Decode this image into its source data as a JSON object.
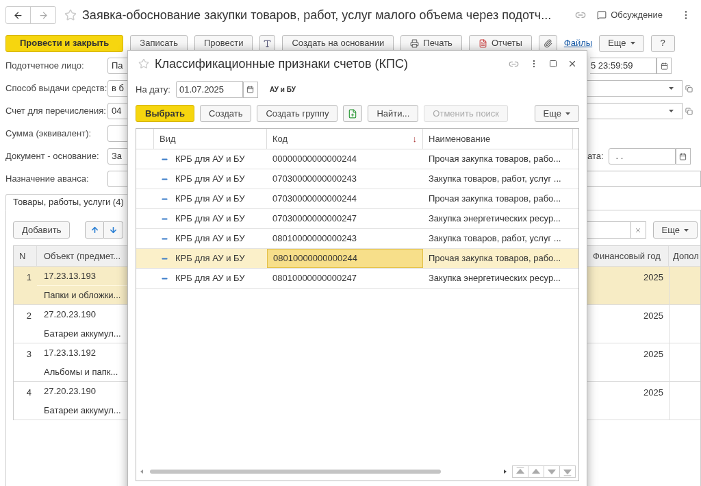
{
  "window": {
    "title": "Заявка-обоснование закупки товаров, работ, услуг малого объема через подотч...",
    "discussion": "Обсуждение"
  },
  "toolbar": [
    {
      "kind": "primary",
      "label": "Провести и закрыть"
    },
    {
      "kind": "plain",
      "label": "Записать"
    },
    {
      "kind": "plain",
      "label": "Провести"
    },
    {
      "kind": "format"
    },
    {
      "kind": "plain",
      "label": "Создать на основании"
    },
    {
      "kind": "printer",
      "label": "Печать"
    },
    {
      "kind": "report",
      "label": "Отчеты"
    },
    {
      "kind": "clip"
    },
    {
      "kind": "link",
      "label": "Файлы"
    },
    {
      "kind": "menu",
      "label": "Еще"
    },
    {
      "kind": "plain",
      "label": "?"
    }
  ],
  "form": [
    {
      "label": "Подотчетное лицо:",
      "value": "Па",
      "right": {
        "kind": "date",
        "value": "5 23:59:59"
      }
    },
    {
      "label": "Способ выдачи средств:",
      "value": "в б",
      "right": {
        "kind": "select"
      }
    },
    {
      "label": "Счет для перечисления:",
      "value": "04",
      "right": {
        "kind": "select"
      }
    },
    {
      "label": "Сумма (эквивалент):",
      "right": {
        "kind": "none"
      }
    },
    {
      "label": "Документ - основание:",
      "value": "За",
      "right": {
        "kind": "labeled-date",
        "label": "ата:",
        "value": ". ."
      }
    },
    {
      "label": "Назначение аванса:",
      "right": {
        "kind": "blank"
      }
    }
  ],
  "tabs": [
    {
      "label": "Товары, работы, услуги (4)",
      "selected": true
    }
  ],
  "items": {
    "add": "Добавить",
    "more": "Еще",
    "columns": [
      "N",
      "Объект (предмет...",
      "Финансовый год",
      "Допол"
    ],
    "rows": [
      {
        "n": "1",
        "code": "17.23.13.193",
        "name": "Папки и обложки...",
        "year": "2025",
        "selected": true
      },
      {
        "n": "2",
        "code": "27.20.23.190",
        "name": "Батареи аккумул...",
        "year": "2025",
        "selected": false
      },
      {
        "n": "3",
        "code": "17.23.13.192",
        "name": "Альбомы и папк...",
        "year": "2025",
        "selected": false
      },
      {
        "n": "4",
        "code": "27.20.23.190",
        "name": "Батареи аккумул...",
        "year": "2025",
        "selected": false
      }
    ]
  },
  "dialog": {
    "title": "Классификационные признаки счетов (КПС)",
    "date_label": "На дату:",
    "date": "01.07.2025",
    "ledger": "АУ и БУ",
    "buttons": [
      {
        "kind": "primary",
        "label": "Выбрать",
        "disabled": false
      },
      {
        "kind": "plain",
        "label": "Создать",
        "disabled": false
      },
      {
        "kind": "plain",
        "label": "Создать группу",
        "disabled": false
      },
      {
        "kind": "add-doc",
        "disabled": false
      },
      {
        "kind": "plain",
        "label": "Найти...",
        "disabled": false
      },
      {
        "kind": "plain",
        "label": "Отменить поиск",
        "disabled": true
      },
      {
        "kind": "menu",
        "label": "Еще",
        "disabled": false
      }
    ],
    "columns": [
      {
        "label": "Вид"
      },
      {
        "label": "Код",
        "sort_mark": "↓"
      },
      {
        "label": "Наименование"
      }
    ],
    "rows": [
      {
        "vid": "КРБ для АУ и БУ",
        "code": "00000000000000244",
        "name": "Прочая закупка товаров, рабо...",
        "selected": false
      },
      {
        "vid": "КРБ для АУ и БУ",
        "code": "07030000000000243",
        "name": "Закупка товаров, работ, услуг ...",
        "selected": false
      },
      {
        "vid": "КРБ для АУ и БУ",
        "code": "07030000000000244",
        "name": "Прочая закупка товаров, рабо...",
        "selected": false
      },
      {
        "vid": "КРБ для АУ и БУ",
        "code": "07030000000000247",
        "name": "Закупка энергетических ресур...",
        "selected": false
      },
      {
        "vid": "КРБ для АУ и БУ",
        "code": "08010000000000243",
        "name": "Закупка товаров, работ, услуг ...",
        "selected": false
      },
      {
        "vid": "КРБ для АУ и БУ",
        "code": "08010000000000244",
        "name": "Прочая закупка товаров, рабо...",
        "selected": true
      },
      {
        "vid": "КРБ для АУ и БУ",
        "code": "08010000000000247",
        "name": "Закупка энергетических ресур...",
        "selected": false
      }
    ]
  }
}
